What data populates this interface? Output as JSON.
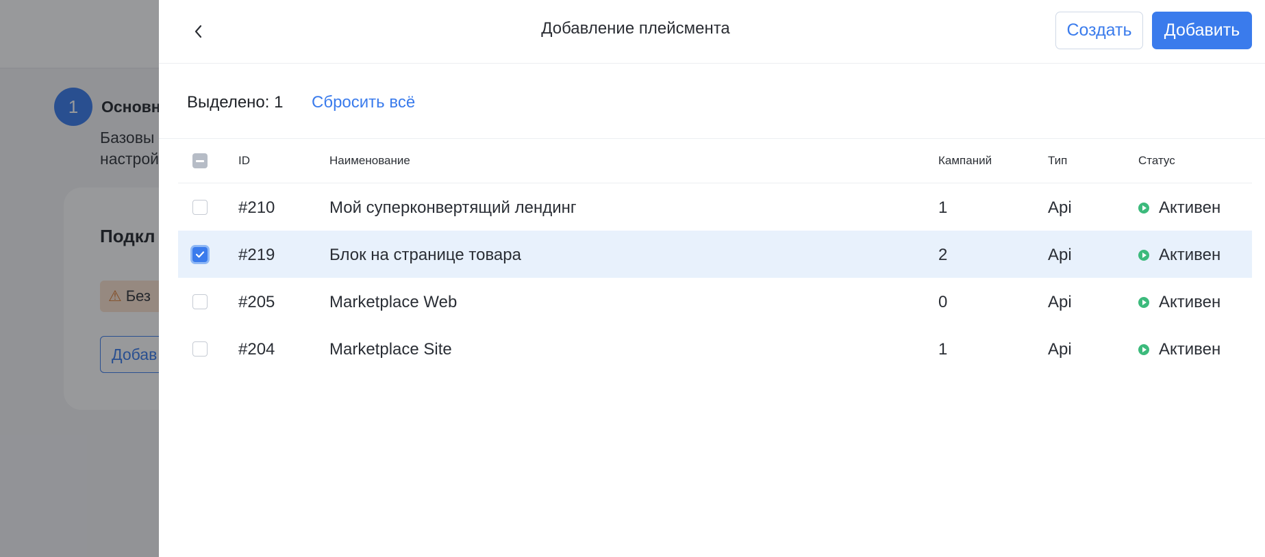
{
  "background": {
    "step_number": "1",
    "step_title": "Основн",
    "step_desc_line1": "Базовы",
    "step_desc_line2": "настрой",
    "card_title": "Подкл",
    "warning_text": "Без",
    "add_button_label": "Добав"
  },
  "drawer": {
    "title": "Добавление плейсмента",
    "create_label": "Создать",
    "add_label": "Добавить",
    "selected_count": "Выделено: 1",
    "reset_label": "Сбросить всё"
  },
  "table": {
    "headers": {
      "id": "ID",
      "name": "Наименование",
      "campaigns": "Кампаний",
      "type": "Тип",
      "status": "Статус"
    },
    "rows": [
      {
        "id": "#210",
        "name": "Мой суперконвертящий лендинг",
        "campaigns": "1",
        "type": "Api",
        "status": "Активен",
        "checked": false
      },
      {
        "id": "#219",
        "name": "Блок на странице товара",
        "campaigns": "2",
        "type": "Api",
        "status": "Активен",
        "checked": true
      },
      {
        "id": "#205",
        "name": "Marketplace Web",
        "campaigns": "0",
        "type": "Api",
        "status": "Активен",
        "checked": false
      },
      {
        "id": "#204",
        "name": "Marketplace Site",
        "campaigns": "1",
        "type": "Api",
        "status": "Активен",
        "checked": false
      }
    ]
  },
  "colors": {
    "accent": "#3a7bec",
    "status_active": "#3cba7c",
    "selected_row": "#e8f1fc"
  }
}
